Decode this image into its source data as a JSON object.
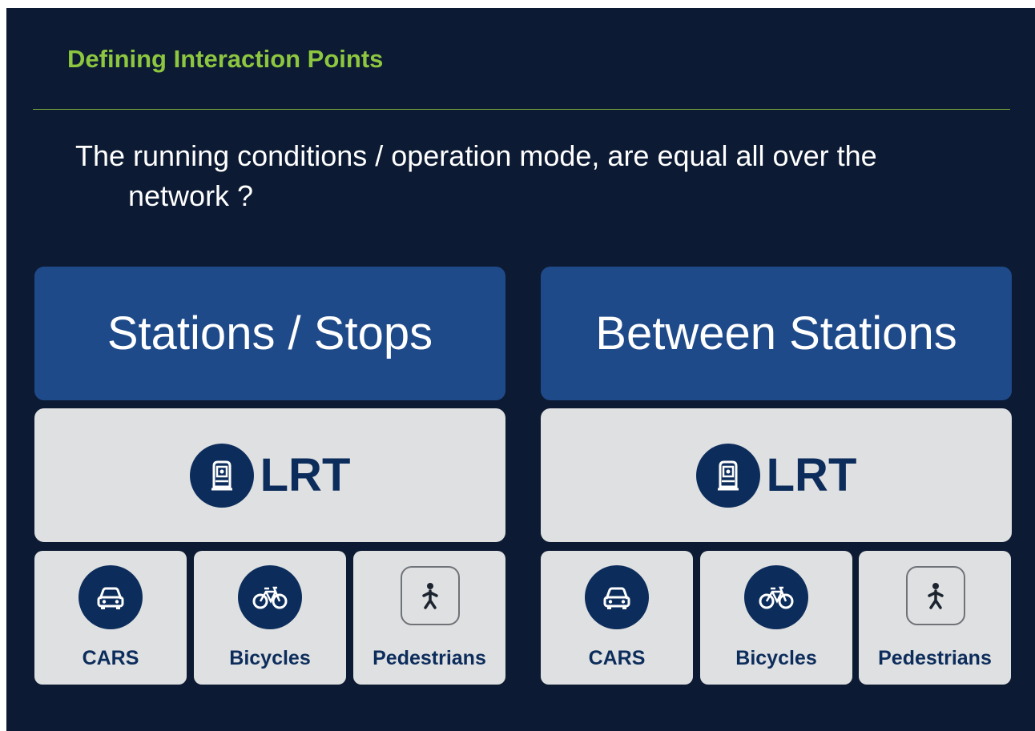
{
  "slide": {
    "title": "Defining Interaction Points",
    "question_line1": "The running conditions / operation mode, are equal all over the",
    "question_line2": "network ?"
  },
  "columns": [
    {
      "header": "Stations / Stops",
      "main": {
        "label": "LRT",
        "icon": "train-icon"
      },
      "modes": [
        {
          "label": "CARS",
          "icon": "car-icon"
        },
        {
          "label": "Bicycles",
          "icon": "bicycle-icon"
        },
        {
          "label": "Pedestrians",
          "icon": "pedestrian-icon"
        }
      ]
    },
    {
      "header": "Between Stations",
      "main": {
        "label": "LRT",
        "icon": "train-icon"
      },
      "modes": [
        {
          "label": "CARS",
          "icon": "car-icon"
        },
        {
          "label": "Bicycles",
          "icon": "bicycle-icon"
        },
        {
          "label": "Pedestrians",
          "icon": "pedestrian-icon"
        }
      ]
    }
  ],
  "colors": {
    "background": "#0c1a33",
    "title": "#8dc63f",
    "header_box": "#1f4a8a",
    "card": "#dfe0e1",
    "icon_navy": "#0c2d5c"
  }
}
